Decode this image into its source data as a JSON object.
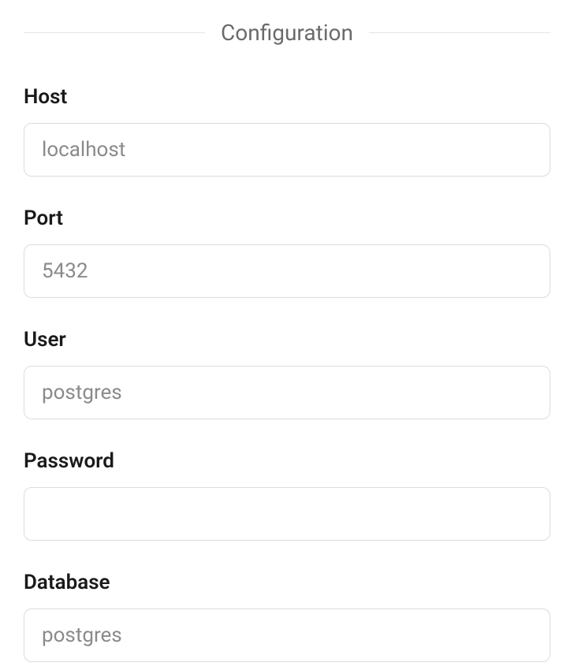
{
  "section": {
    "title": "Configuration"
  },
  "fields": {
    "host": {
      "label": "Host",
      "placeholder": "localhost",
      "value": ""
    },
    "port": {
      "label": "Port",
      "placeholder": "5432",
      "value": ""
    },
    "user": {
      "label": "User",
      "placeholder": "postgres",
      "value": ""
    },
    "password": {
      "label": "Password",
      "placeholder": "",
      "value": ""
    },
    "database": {
      "label": "Database",
      "placeholder": "postgres",
      "value": ""
    }
  }
}
